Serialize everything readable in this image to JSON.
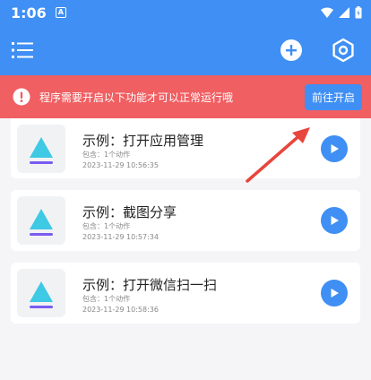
{
  "status": {
    "time": "1:06",
    "notification_icon": "A"
  },
  "colors": {
    "primary": "#3f8ff4",
    "alert": "#f05f62"
  },
  "banner": {
    "message": "程序需要开启以下功能才可以正常运行哦",
    "action_label": "前往开启"
  },
  "tasks": [
    {
      "title": "示例：打开应用管理",
      "contains": "包含：1个动作",
      "timestamp": "2023-11-29 10:56:35"
    },
    {
      "title": "示例：截图分享",
      "contains": "包含：1个动作",
      "timestamp": "2023-11-29 10:57:34"
    },
    {
      "title": "示例：打开微信扫一扫",
      "contains": "包含：1个动作",
      "timestamp": "2023-11-29 10:58:36"
    }
  ]
}
